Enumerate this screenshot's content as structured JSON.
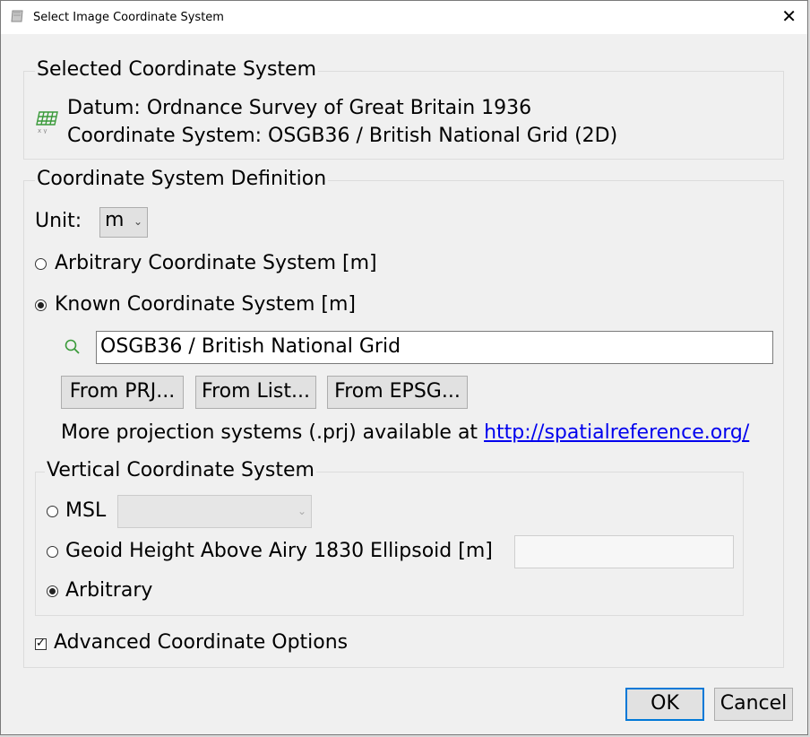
{
  "window": {
    "title": "Select Image Coordinate System",
    "close_glyph": "✕"
  },
  "selected": {
    "group_title": "Selected Coordinate System",
    "icon": "grid-xy-icon",
    "datum": "Datum: Ordnance Survey of Great Britain 1936",
    "coord_system": "Coordinate System: OSGB36 / British National Grid (2D)"
  },
  "definition": {
    "group_title": "Coordinate System Definition",
    "unit_label": "Unit:",
    "unit_value": "m",
    "arbitrary_label": "Arbitrary Coordinate System [m]",
    "arbitrary_checked": false,
    "known_label": "Known Coordinate System [m]",
    "known_checked": true,
    "search_value": "OSGB36 / British National Grid",
    "buttons": {
      "from_prj": "From PRJ...",
      "from_list": "From List...",
      "from_epsg": "From EPSG..."
    },
    "more_text": "More projection systems (.prj) available at",
    "more_link": "http://spatialreference.org/"
  },
  "vertical": {
    "group_title": "Vertical Coordinate System",
    "msl_label": "MSL",
    "msl_value": "",
    "geoid_label": "Geoid Height Above Airy 1830 Ellipsoid [m]",
    "geoid_value": "",
    "arbitrary_label": "Arbitrary",
    "selected": "Arbitrary"
  },
  "advanced": {
    "label": "Advanced Coordinate Options",
    "checked": true
  },
  "footer": {
    "ok": "OK",
    "cancel": "Cancel"
  },
  "colors": {
    "accent": "#0078d7",
    "link": "#0000ee",
    "icon_green": "#3a9a3a"
  }
}
